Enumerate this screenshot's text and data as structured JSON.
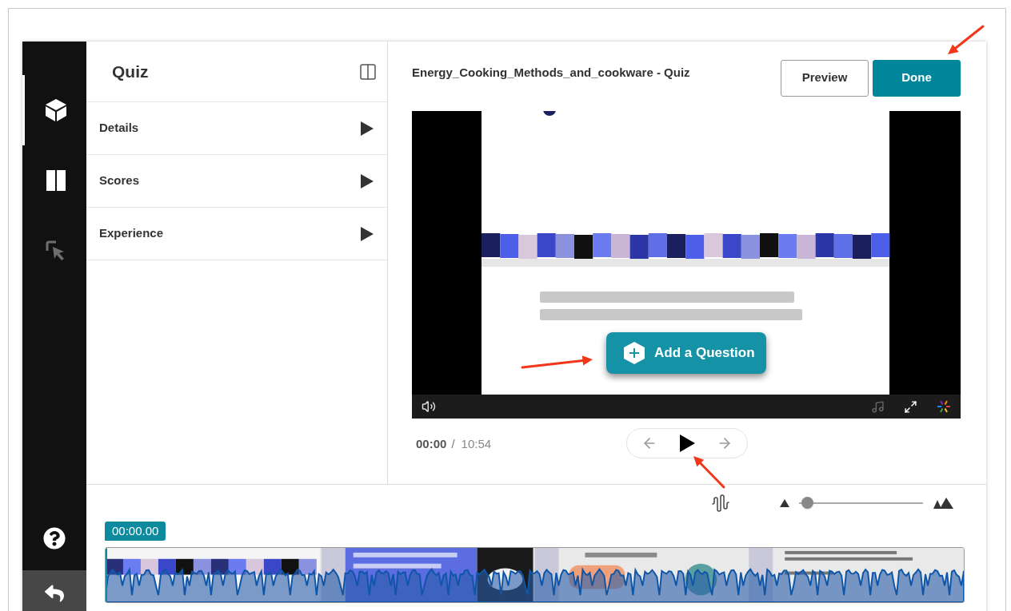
{
  "sidebar": {
    "items": [
      {
        "kind": "cube",
        "selected": true,
        "disabled": false
      },
      {
        "kind": "split",
        "selected": false,
        "disabled": false
      },
      {
        "kind": "cursor",
        "selected": false,
        "disabled": true
      }
    ],
    "bottom": [
      {
        "kind": "help"
      },
      {
        "kind": "back"
      }
    ]
  },
  "panel": {
    "title": "Quiz",
    "sections": [
      {
        "label": "Details",
        "expanded": false
      },
      {
        "label": "Scores",
        "expanded": false
      },
      {
        "label": "Experience",
        "expanded": false
      }
    ]
  },
  "editor": {
    "title": "Energy_Cooking_Methods_and_cookware - Quiz",
    "buttons": [
      {
        "label": "Preview",
        "kind": "secondary"
      },
      {
        "label": "Done",
        "kind": "primary"
      }
    ],
    "video": {
      "overlay_button": "Add a Question"
    },
    "time": {
      "current": "00:00",
      "separator": "/",
      "total": "10:54"
    }
  },
  "timeline": {
    "timestamp": "00:00.00",
    "zoom": {
      "level": 0.02
    }
  }
}
